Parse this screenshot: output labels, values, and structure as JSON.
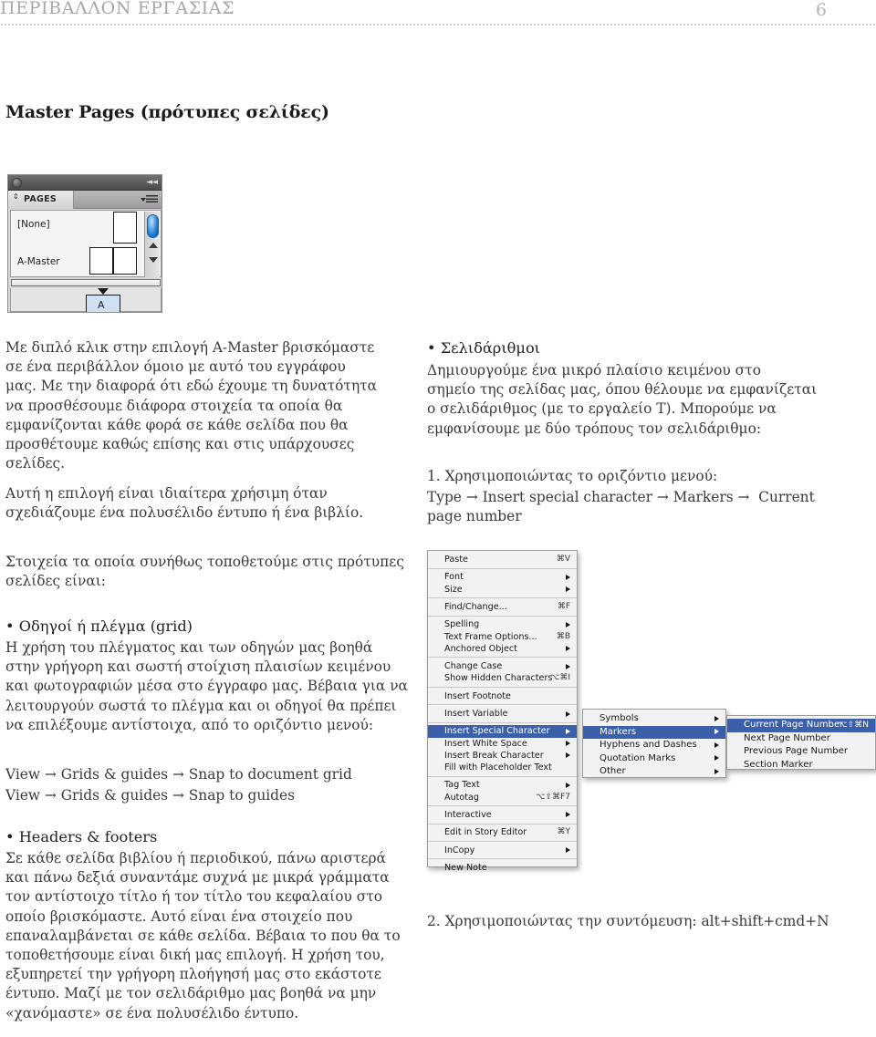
{
  "header": {
    "running_title": "ΠΕΡΙΒΑΛΛΟΝ ΕΡΓΑΣΙΑΣ",
    "page_number": "6"
  },
  "section": {
    "title": "Master Pages (πρότυπες σελίδες)"
  },
  "pages_panel": {
    "tab_label": "PAGES",
    "rows": [
      {
        "label": "[None]"
      },
      {
        "label": "A-Master"
      }
    ],
    "document_page_letter": "A"
  },
  "left_column": {
    "para1": "Με διπλό κλικ στην επιλογή A-Master βρισκόμαστε\nσε ένα περιβάλλον όμοιο με αυτό του εγγράφου\nμας. Με την διαφορά ότι εδώ έχουμε τη δυνατότητα\nνα προσθέσουμε διάφορα στοιχεία τα οποία θα\nεμφανίζονται κάθε φορά σε κάθε σελίδα που θα\nπροσθέτουμε καθώς επίσης και στις υπάρχουσες σελίδες.",
    "para2": "Αυτή η επιλογή είναι ιδιαίτερα χρήσιμη όταν\nσχεδιάζουμε ένα πολυσέλιδο έντυπο ή ένα βιβλίο.",
    "para3": "Στοιχεία τα οποία συνήθως τοποθετούμε στις πρότυπες\nσελίδες είναι:",
    "bullet1": "• Οδηγοί ή πλέγμα (grid)",
    "para4": "Η χρήση του πλέγματος και των οδηγών μας βοηθά\nστην γρήγορη και σωστή στοίχιση πλαισίων κειμένου\nκαι φωτογραφιών μέσα στο έγγραφο μας. Βέβαια για να\nλειτουργούν σωστά το πλέγμα και οι οδηγοί θα πρέπει\nνα επιλέξουμε αντίστοιχα, από το οριζόντιο μενού:",
    "path1": "View → Grids & guides → Snap to document grid",
    "path2": "View → Grids & guides → Snap to guides",
    "bullet2": "• Headers & footers",
    "para5": "Σε κάθε σελίδα βιβλίου ή περιοδικού, πάνω αριστερά\nκαι πάνω δεξιά συναντάμε συχνά με μικρά γράμματα\nτον αντίστοιχο τίτλο ή τον τίτλο του κεφαλαίου στο\nοποίο βρισκόμαστε. Αυτό είναι ένα στοιχείο που\nεπαναλαμβάνεται σε κάθε σελίδα. Βέβαια το που θα το\nτοποθετήσουμε είναι δική μας επιλογή. Η χρήση του,\nεξυπηρετεί την γρήγορη πλοήγησή μας στο εκάστοτε\nέντυπο. Μαζί με τον σελιδάριθμο μας βοηθά να μην\n«χανόμαστε» σε ένα πολυσέλιδο έντυπο."
  },
  "right_column": {
    "bullet1": "• Σελιδάριθμοι",
    "para1": "Δημιουργούμε ένα μικρό πλαίσιο κειμένου στο\nσημείο της σελίδας μας, όπου θέλουμε να εμφανίζεται\nο σελιδάριθμος (με το εργαλείο T). Μπορούμε να\nεμφανίσουμε με δύο τρόπους τον σελιδάριθμο:",
    "step1_intro": "1. Χρησιμοποιώντας το οριζόντιο μενού:",
    "step1_path": "Type → Insert special character → Markers →  Current\npage number",
    "step2": "2. Χρησιμοποιώντας την συντόμευση: alt+shift+cmd+N"
  },
  "menu_screenshot": {
    "type_menu": [
      {
        "label": "Paste",
        "shortcut": "⌘V",
        "submenu": false
      },
      {
        "sep": true
      },
      {
        "label": "Font",
        "shortcut": "",
        "submenu": true
      },
      {
        "label": "Size",
        "shortcut": "",
        "submenu": true
      },
      {
        "sep": true
      },
      {
        "label": "Find/Change...",
        "shortcut": "⌘F",
        "submenu": false
      },
      {
        "sep": true
      },
      {
        "label": "Spelling",
        "shortcut": "",
        "submenu": true
      },
      {
        "label": "Text Frame Options...",
        "shortcut": "⌘B",
        "submenu": false
      },
      {
        "label": "Anchored Object",
        "shortcut": "",
        "submenu": true
      },
      {
        "sep": true
      },
      {
        "label": "Change Case",
        "shortcut": "",
        "submenu": true
      },
      {
        "label": "Show Hidden Characters",
        "shortcut": "⌥⌘I",
        "submenu": false
      },
      {
        "sep": true
      },
      {
        "label": "Insert Footnote",
        "shortcut": "",
        "submenu": false
      },
      {
        "sep": true
      },
      {
        "label": "Insert Variable",
        "shortcut": "",
        "submenu": true
      },
      {
        "sep": true
      },
      {
        "label": "Insert Special Character",
        "shortcut": "",
        "submenu": true,
        "selected": true
      },
      {
        "label": "Insert White Space",
        "shortcut": "",
        "submenu": true
      },
      {
        "label": "Insert Break Character",
        "shortcut": "",
        "submenu": true
      },
      {
        "label": "Fill with Placeholder Text",
        "shortcut": "",
        "submenu": false
      },
      {
        "sep": true
      },
      {
        "label": "Tag Text",
        "shortcut": "",
        "submenu": true
      },
      {
        "label": "Autotag",
        "shortcut": "⌥⇧⌘F7",
        "submenu": false
      },
      {
        "sep": true
      },
      {
        "label": "Interactive",
        "shortcut": "",
        "submenu": true
      },
      {
        "sep": true
      },
      {
        "label": "Edit in Story Editor",
        "shortcut": "⌘Y",
        "submenu": false
      },
      {
        "sep": true
      },
      {
        "label": "InCopy",
        "shortcut": "",
        "submenu": true
      },
      {
        "sep": true
      },
      {
        "label": "New Note",
        "shortcut": "",
        "submenu": false
      }
    ],
    "special_character_submenu": [
      {
        "label": "Symbols",
        "shortcut": "",
        "submenu": true
      },
      {
        "label": "Markers",
        "shortcut": "",
        "submenu": true,
        "selected": true
      },
      {
        "label": "Hyphens and Dashes",
        "shortcut": "",
        "submenu": true
      },
      {
        "label": "Quotation Marks",
        "shortcut": "",
        "submenu": true
      },
      {
        "label": "Other",
        "shortcut": "",
        "submenu": true
      }
    ],
    "markers_submenu": [
      {
        "label": "Current Page Number",
        "shortcut": "⌥⇧⌘N",
        "submenu": false,
        "selected": true
      },
      {
        "label": "Next Page Number",
        "shortcut": "",
        "submenu": false
      },
      {
        "label": "Previous Page Number",
        "shortcut": "",
        "submenu": false
      },
      {
        "label": "Section Marker",
        "shortcut": "",
        "submenu": false
      }
    ]
  },
  "colors": {
    "menu_highlight": "#3b5fa8",
    "header_gray": "#a7a7a7",
    "body_text": "#3a3a3a",
    "page_thumb_blue": "#cfe0f2"
  }
}
